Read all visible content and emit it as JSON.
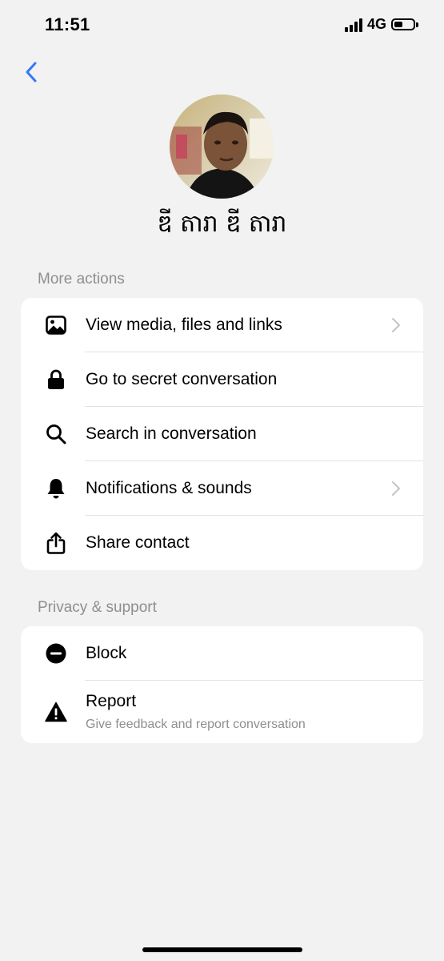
{
  "status_bar": {
    "time": "11:51",
    "network": "4G",
    "signal_icon": "cellular-signal-icon",
    "battery_icon": "battery-icon"
  },
  "nav": {
    "back_icon": "chevron-left-icon",
    "accent_color": "#3478f6"
  },
  "profile": {
    "name": "ឌី តារា ឌី តារា",
    "avatar": "profile-photo"
  },
  "more_actions": {
    "title": "More actions",
    "items": [
      {
        "label": "View media, files and links",
        "icon": "image-icon",
        "chevron": true
      },
      {
        "label": "Go to secret conversation",
        "icon": "lock-icon",
        "chevron": false
      },
      {
        "label": "Search in conversation",
        "icon": "search-icon",
        "chevron": false
      },
      {
        "label": "Notifications & sounds",
        "icon": "bell-icon",
        "chevron": true
      },
      {
        "label": "Share contact",
        "icon": "share-icon",
        "chevron": false
      }
    ]
  },
  "privacy_support": {
    "title": "Privacy & support",
    "items": [
      {
        "label": "Block",
        "icon": "block-icon"
      },
      {
        "label": "Report",
        "sublabel": "Give feedback and report conversation",
        "icon": "warning-icon"
      }
    ]
  }
}
